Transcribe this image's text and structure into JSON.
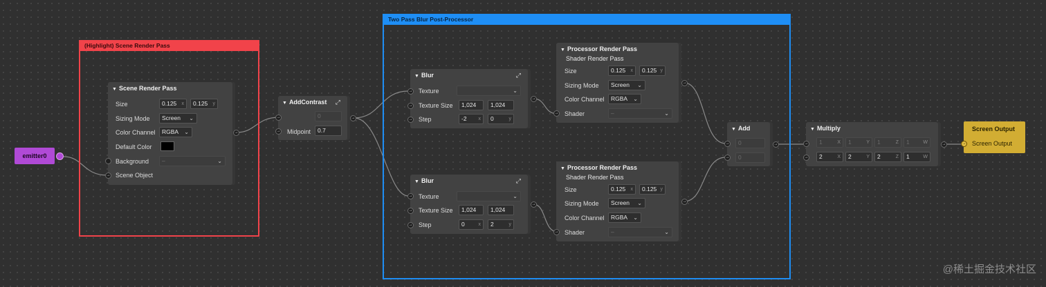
{
  "emitter": {
    "label": "emitter0"
  },
  "frames": {
    "highlight": "(Highlight) Scene Render Pass",
    "blur": "Two Pass Blur Post-Processor"
  },
  "scene_pass": {
    "title": "Scene Render Pass",
    "size_label": "Size",
    "size_x": "0.125",
    "size_y": "0.125",
    "sizing_mode_label": "Sizing Mode",
    "sizing_mode": "Screen",
    "color_channel_label": "Color Channel",
    "color_channel": "RGBA",
    "default_color_label": "Default Color",
    "default_color": "#000000",
    "background_label": "Background",
    "background": "–",
    "scene_object_label": "Scene Object"
  },
  "add_contrast": {
    "title": "AddContrast",
    "input": "0",
    "midpoint_label": "Midpoint",
    "midpoint": "0.7"
  },
  "blur1": {
    "title": "Blur",
    "texture_label": "Texture",
    "texture_size_label": "Texture Size",
    "texture_size_x": "1,024",
    "texture_size_y": "1,024",
    "step_label": "Step",
    "step_x": "-2",
    "step_y": "0"
  },
  "blur2": {
    "title": "Blur",
    "texture_label": "Texture",
    "texture_size_label": "Texture Size",
    "texture_size_x": "1,024",
    "texture_size_y": "1,024",
    "step_label": "Step",
    "step_x": "0",
    "step_y": "2"
  },
  "proc1": {
    "title": "Processor Render Pass",
    "subtitle": "Shader Render Pass",
    "size_label": "Size",
    "size_x": "0.125",
    "size_y": "0.125",
    "sizing_mode_label": "Sizing Mode",
    "sizing_mode": "Screen",
    "color_channel_label": "Color Channel",
    "color_channel": "RGBA",
    "shader_label": "Shader",
    "shader": "–"
  },
  "proc2": {
    "title": "Processor Render Pass",
    "subtitle": "Shader Render Pass",
    "size_label": "Size",
    "size_x": "0.125",
    "size_y": "0.125",
    "sizing_mode_label": "Sizing Mode",
    "sizing_mode": "Screen",
    "color_channel_label": "Color Channel",
    "color_channel": "RGBA",
    "shader_label": "Shader",
    "shader": "–"
  },
  "add": {
    "title": "Add",
    "a": "0",
    "b": "0"
  },
  "multiply": {
    "title": "Multiply",
    "row1": [
      "1",
      "1",
      "1",
      "1"
    ],
    "row2": [
      "2",
      "2",
      "2",
      "1"
    ],
    "axes": [
      "X",
      "Y",
      "Z",
      "W"
    ]
  },
  "screen_output": {
    "title": "Screen Output",
    "input_label": "Screen Output"
  },
  "watermark": "@稀土掘金技术社区",
  "colors": {
    "highlight_frame": "#f1434a",
    "blur_frame": "#1e8ef5",
    "emitter": "#b04ad6",
    "screen_output": "#d2ad33"
  }
}
